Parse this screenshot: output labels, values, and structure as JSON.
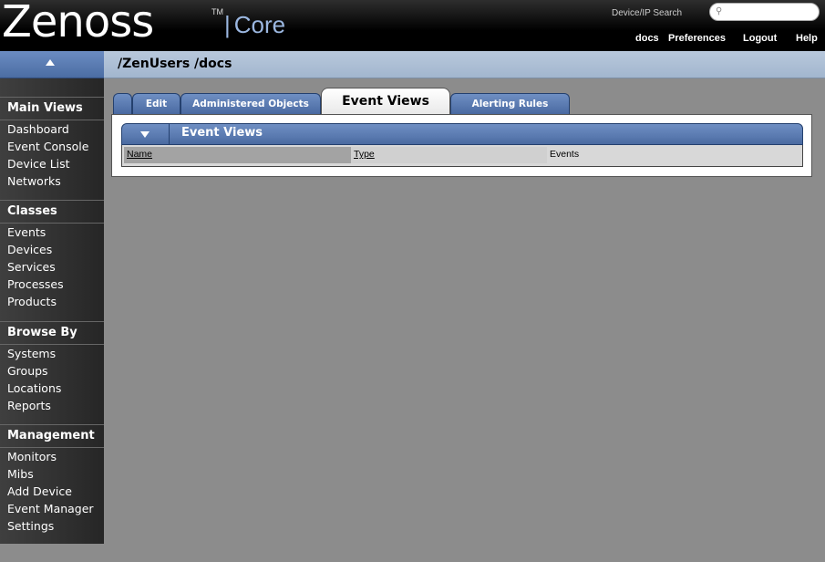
{
  "header": {
    "logo": "Zenoss",
    "trademark": "TM",
    "product": "Core",
    "search_label": "Device/IP Search",
    "search_placeholder": "",
    "links": [
      {
        "label": "docs"
      },
      {
        "label": "Preferences"
      },
      {
        "label": "Logout"
      },
      {
        "label": "Help"
      }
    ]
  },
  "breadcrumb": "/ZenUsers /docs",
  "sidebar": {
    "sections": [
      {
        "title": "Main Views",
        "items": [
          "Dashboard",
          "Event Console",
          "Device List",
          "Networks"
        ]
      },
      {
        "title": "Classes",
        "items": [
          "Events",
          "Devices",
          "Services",
          "Processes",
          "Products"
        ]
      },
      {
        "title": "Browse By",
        "items": [
          "Systems",
          "Groups",
          "Locations",
          "Reports"
        ]
      },
      {
        "title": "Management",
        "items": [
          "Monitors",
          "Mibs",
          "Add Device",
          "Event Manager",
          "Settings"
        ]
      }
    ]
  },
  "tabs": [
    {
      "label": "Edit"
    },
    {
      "label": "Administered Objects"
    },
    {
      "label": "Event Views"
    },
    {
      "label": "Alerting Rules"
    }
  ],
  "event_views": {
    "title": "Event Views",
    "columns": [
      {
        "label": "Name"
      },
      {
        "label": "Type"
      },
      {
        "label": "Events"
      }
    ]
  },
  "colors": {
    "accent_blue": "#5a7ab0",
    "core_text": "#9bb7e0",
    "breadcrumb_bg": "#a2b6ce"
  }
}
